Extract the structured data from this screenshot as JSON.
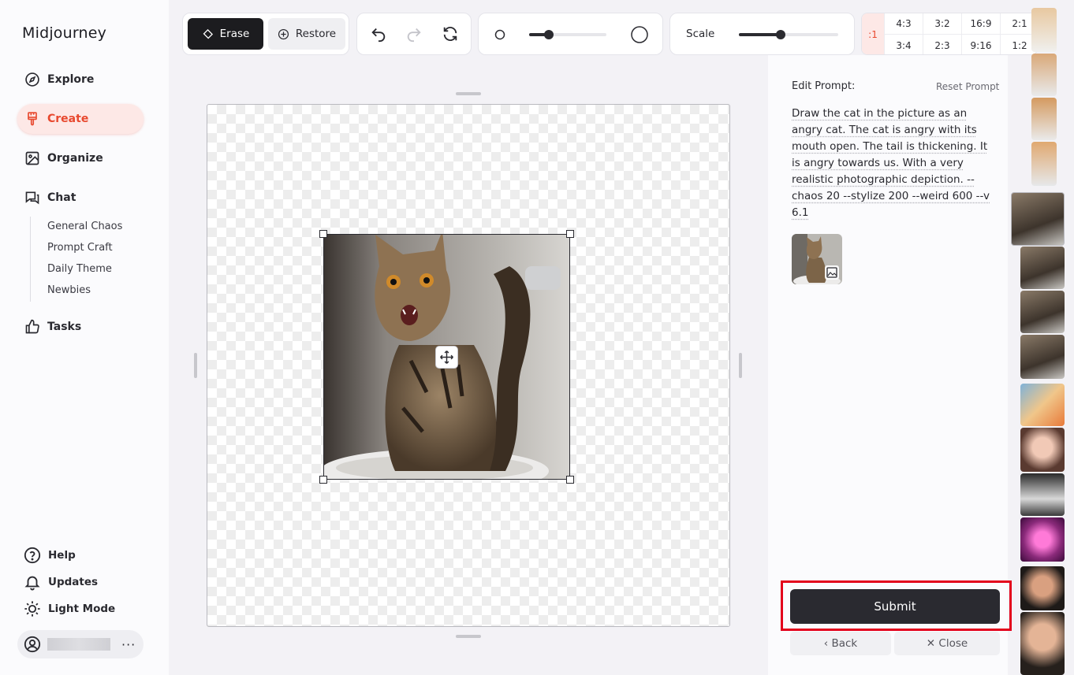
{
  "app": {
    "title": "Midjourney"
  },
  "sidebar": {
    "nav": [
      {
        "label": "Explore",
        "icon": "compass-icon"
      },
      {
        "label": "Create",
        "icon": "brush-icon",
        "active": true
      },
      {
        "label": "Organize",
        "icon": "image-icon"
      },
      {
        "label": "Chat",
        "icon": "chat-icon"
      }
    ],
    "chat_channels": [
      "General Chaos",
      "Prompt Craft",
      "Daily Theme",
      "Newbies"
    ],
    "tasks": {
      "label": "Tasks",
      "icon": "thumbs-up-icon"
    },
    "bottom": [
      {
        "label": "Help",
        "icon": "help-icon"
      },
      {
        "label": "Updates",
        "icon": "bell-icon"
      },
      {
        "label": "Light Mode",
        "icon": "sun-icon"
      }
    ],
    "user": {
      "more": "···"
    }
  },
  "toolbar": {
    "erase_label": "Erase",
    "restore_label": "Restore",
    "brush_size": 0.25,
    "scale_label": "Scale",
    "scale_value": 0.42,
    "ratio_partial": ":1",
    "ratios_top": [
      "4:3",
      "3:2",
      "16:9",
      "2:1"
    ],
    "ratios_bottom": [
      "3:4",
      "2:3",
      "9:16",
      "1:2"
    ]
  },
  "editor": {
    "edit_prompt_label": "Edit Prompt:",
    "reset_prompt_label": "Reset Prompt",
    "prompt": "Draw the cat in the picture as an angry cat. The cat is angry with its mouth open. The tail is thickening. It is angry towards us. With a very realistic photographic depiction. --chaos 20 --stylize 200 --weird 600 --v 6.1",
    "submit_label": "Submit",
    "back_label": "‹ Back",
    "close_label": "✕ Close"
  },
  "colors": {
    "accent": "#e8492f",
    "highlight": "#e3001b",
    "dark": "#2a2a30"
  }
}
